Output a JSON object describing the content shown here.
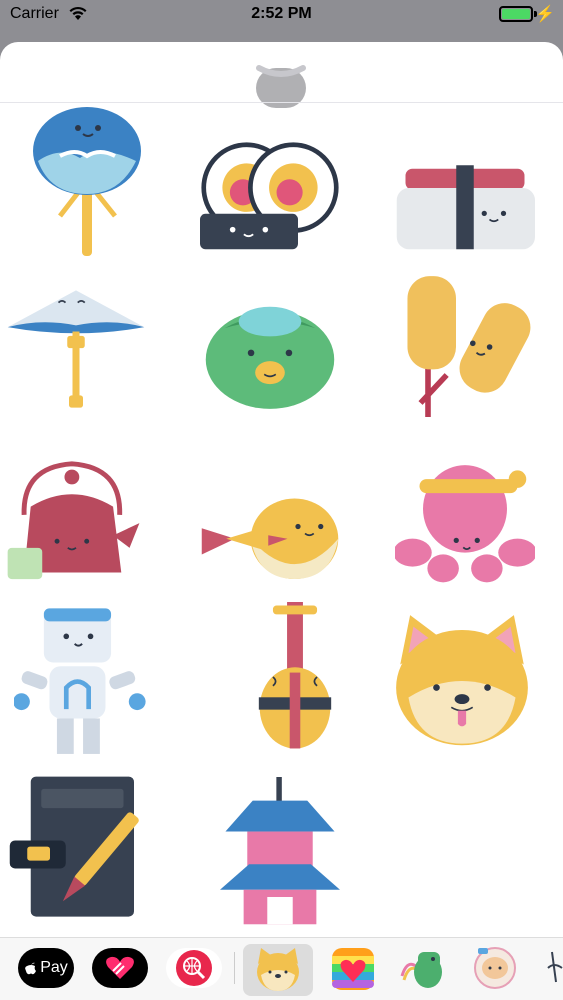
{
  "status_bar": {
    "carrier": "Carrier",
    "time": "2:52 PM",
    "battery_level_percent": 100,
    "battery_color": "#4cd964"
  },
  "stickers": [
    {
      "name": "uchiwa-fan-sticker"
    },
    {
      "name": "sushi-roll-sticker"
    },
    {
      "name": "nigiri-sticker"
    },
    {
      "name": "umbrella-sticker"
    },
    {
      "name": "kappa-sticker"
    },
    {
      "name": "tempura-skewer-sticker"
    },
    {
      "name": "teapot-sticker"
    },
    {
      "name": "pufferfish-sticker"
    },
    {
      "name": "octopus-sticker"
    },
    {
      "name": "robot-sticker"
    },
    {
      "name": "shamisen-sticker"
    },
    {
      "name": "shiba-dog-sticker"
    },
    {
      "name": "calligraphy-tablet-sticker"
    },
    {
      "name": "pagoda-sticker"
    }
  ],
  "app_drawer": {
    "apple_pay_label": "Pay",
    "items": [
      "apple-pay-app",
      "digital-touch-app",
      "search-images-app",
      "japan-sticker-app",
      "hearts-app",
      "dinosaur-app",
      "astronaut-app"
    ]
  }
}
